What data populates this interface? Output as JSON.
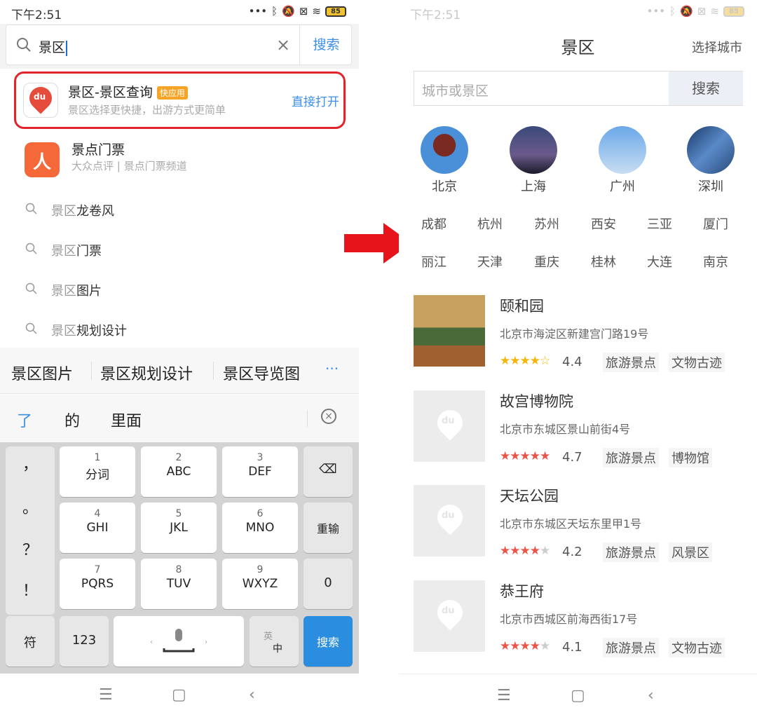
{
  "left": {
    "status": {
      "time": "下午2:51",
      "battery": "85"
    },
    "search": {
      "query": "景区",
      "button": "搜索"
    },
    "app_suggestion": {
      "title": "景区-景区查询",
      "badge": "快应用",
      "subtitle": "景区选择更快捷，出游方式更简单",
      "action": "直接打开"
    },
    "app2": {
      "title": "景点门票",
      "subtitle": "大众点评 | 景点门票频道"
    },
    "suggestions": [
      {
        "prefix": "景区",
        "suffix": "龙卷风"
      },
      {
        "prefix": "景区",
        "suffix": "门票"
      },
      {
        "prefix": "景区",
        "suffix": "图片"
      },
      {
        "prefix": "景区",
        "suffix": "规划设计"
      }
    ],
    "candidates": [
      "景区图片",
      "景区规划设计",
      "景区导览图"
    ],
    "candidates_more": "···",
    "pinyin": [
      "了",
      "的",
      "里面"
    ],
    "keyboard": {
      "symbols": [
        "，",
        "。",
        "？",
        "！"
      ],
      "keys": [
        {
          "n": "1",
          "l": "分词"
        },
        {
          "n": "2",
          "l": "ABC"
        },
        {
          "n": "3",
          "l": "DEF"
        },
        {
          "n": "4",
          "l": "GHI"
        },
        {
          "n": "5",
          "l": "JKL"
        },
        {
          "n": "6",
          "l": "MNO"
        },
        {
          "n": "7",
          "l": "PQRS"
        },
        {
          "n": "8",
          "l": "TUV"
        },
        {
          "n": "9",
          "l": "WXYZ"
        }
      ],
      "reinput": "重输",
      "zero": "0",
      "fu": "符",
      "num": "123",
      "lang_top": "英",
      "lang_bottom": "中",
      "search": "搜索"
    }
  },
  "right": {
    "status": {
      "time": "下午2:51",
      "battery": "85"
    },
    "title": "景区",
    "select_city": "选择城市",
    "search_placeholder": "城市或景区",
    "search_button": "搜索",
    "hot_cities": [
      "北京",
      "上海",
      "广州",
      "深圳"
    ],
    "cities_row1": [
      "成都",
      "杭州",
      "苏州",
      "西安",
      "三亚",
      "厦门"
    ],
    "cities_row2": [
      "丽江",
      "天津",
      "重庆",
      "桂林",
      "大连",
      "南京"
    ],
    "places": [
      {
        "name": "颐和园",
        "address": "北京市海淀区新建宫门路19号",
        "rating": "4.4",
        "stars": 4.5,
        "tags": [
          "旅游景点",
          "文物古迹"
        ]
      },
      {
        "name": "故宫博物院",
        "address": "北京市东城区景山前街4号",
        "rating": "4.7",
        "stars": 5,
        "tags": [
          "旅游景点",
          "博物馆"
        ]
      },
      {
        "name": "天坛公园",
        "address": "北京市东城区天坛东里甲1号",
        "rating": "4.2",
        "stars": 4,
        "tags": [
          "旅游景点",
          "风景区"
        ]
      },
      {
        "name": "恭王府",
        "address": "北京市西城区前海西街17号",
        "rating": "4.1",
        "stars": 4,
        "tags": [
          "旅游景点",
          "文物古迹"
        ]
      }
    ]
  },
  "colors": {
    "accent": "#3b8fe8",
    "highlight_border": "#e1242b",
    "arrow": "#e8141b",
    "star_gold": "#f5b50a",
    "star_red": "#e8564a"
  }
}
